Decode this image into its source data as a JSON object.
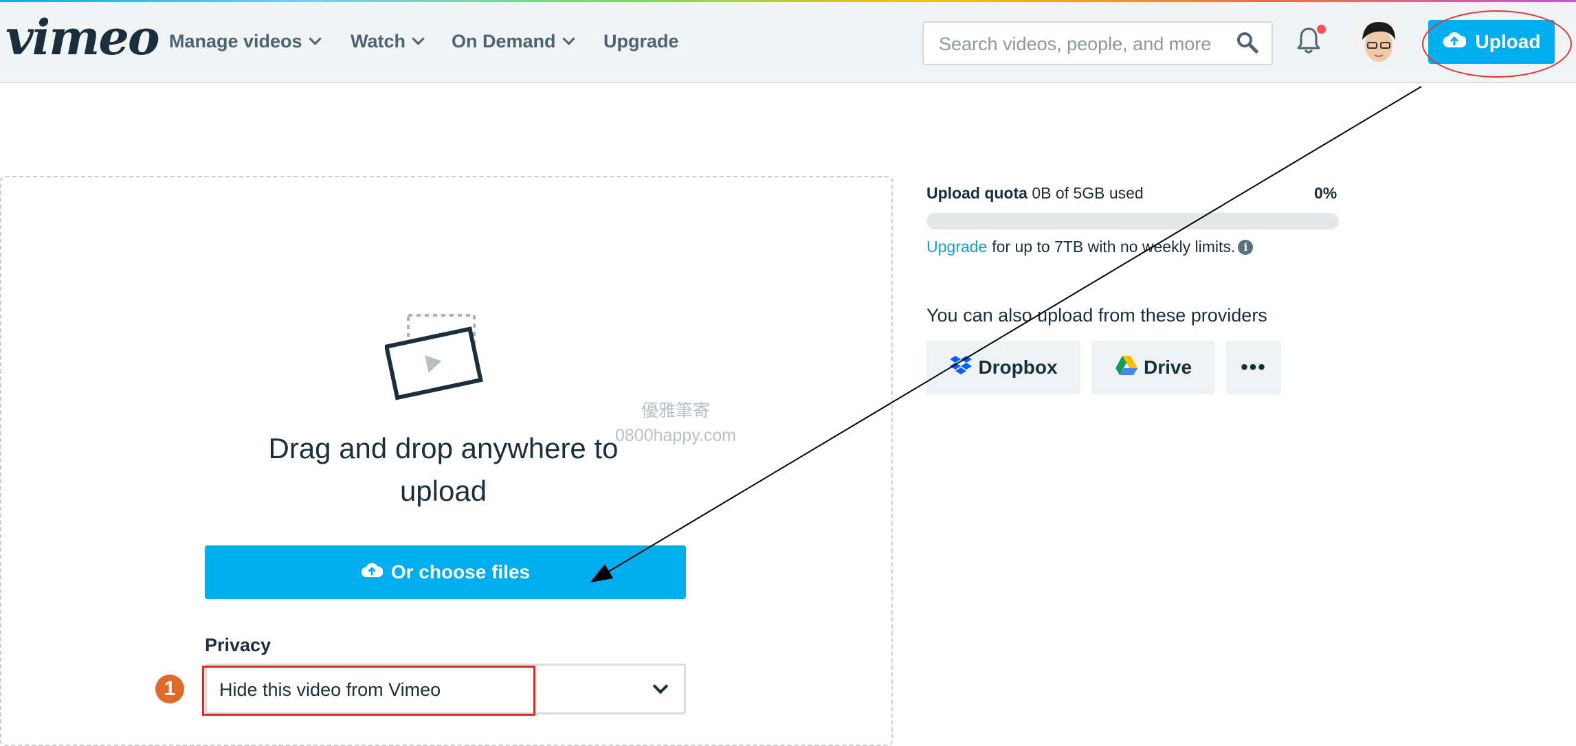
{
  "header": {
    "logo": "vimeo",
    "nav": [
      {
        "label": "Manage videos",
        "has_dropdown": true
      },
      {
        "label": "Watch",
        "has_dropdown": true
      },
      {
        "label": "On Demand",
        "has_dropdown": true
      },
      {
        "label": "Upgrade",
        "has_dropdown": false
      }
    ],
    "search_placeholder": "Search videos, people, and more",
    "search_icon": "search-icon",
    "notification_icon": "bell-icon",
    "upload_label": "Upload",
    "upload_icon": "cloud-upload-icon"
  },
  "dropzone": {
    "icon": "video-frame-icon",
    "text": "Drag and drop anywhere to upload",
    "choose_label": "Or choose files",
    "watermark_line1": "優雅筆寄",
    "watermark_line2": "0800happy.com"
  },
  "privacy": {
    "label": "Privacy",
    "selected": "Hide this video from Vimeo",
    "step_badge": "1"
  },
  "quota": {
    "label": "Upload quota",
    "used_text": "0B of 5GB used",
    "percent_text": "0%",
    "percent": 0,
    "upgrade_link": "Upgrade",
    "upgrade_text": "for up to 7TB with no weekly limits."
  },
  "providers": {
    "label": "You can also upload from these providers",
    "items": [
      {
        "label": "Dropbox",
        "icon": "dropbox-icon"
      },
      {
        "label": "Drive",
        "icon": "google-drive-icon"
      },
      {
        "label": "",
        "icon": "more-icon"
      }
    ]
  },
  "colors": {
    "accent": "#00adef",
    "annotation_red": "#e53030",
    "text_dark": "#1a2e3b"
  }
}
